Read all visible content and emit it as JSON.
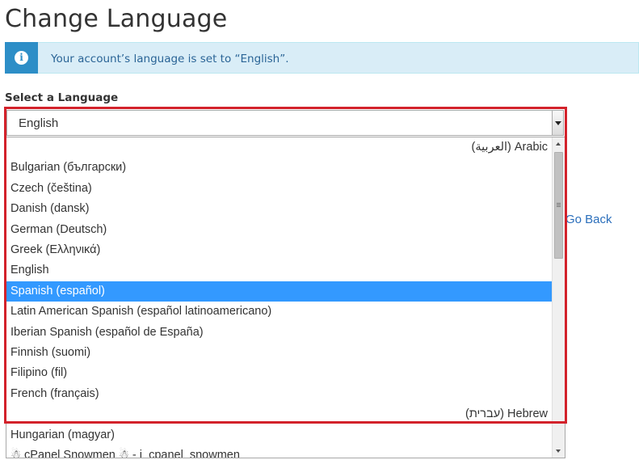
{
  "page": {
    "title": "Change Language"
  },
  "alert": {
    "icon": "info-icon",
    "icon_glyph": "i",
    "message": "Your account’s language is set to “English”."
  },
  "form": {
    "select_label": "Select a Language",
    "selected_value": "English",
    "go_back_label": "Go Back"
  },
  "language_options": [
    {
      "label": "(العربية) Arabic",
      "rtl": true
    },
    {
      "label": "Bulgarian (български)"
    },
    {
      "label": "Czech (čeština)"
    },
    {
      "label": "Danish (dansk)"
    },
    {
      "label": "German (Deutsch)"
    },
    {
      "label": "Greek (Ελληνικά)"
    },
    {
      "label": "English"
    },
    {
      "label": "Spanish (español)",
      "highlighted": true
    },
    {
      "label": "Latin American Spanish (español latinoamericano)"
    },
    {
      "label": "Iberian Spanish (español de España)"
    },
    {
      "label": "Finnish (suomi)"
    },
    {
      "label": "Filipino (fil)"
    },
    {
      "label": "French (français)"
    },
    {
      "label": "(עברית) Hebrew",
      "rtl": true
    },
    {
      "label": "Hungarian (magyar)"
    },
    {
      "label": "☃ cPanel Snowmen ☃ - i_cpanel_snowmen"
    }
  ],
  "colors": {
    "alert_bg": "#d9edf7",
    "alert_icon_bg": "#2d8ec7",
    "alert_text": "#2a6496",
    "selected_option_bg": "#3399ff",
    "highlight_frame": "#d3222b",
    "link": "#2a6ebb"
  }
}
